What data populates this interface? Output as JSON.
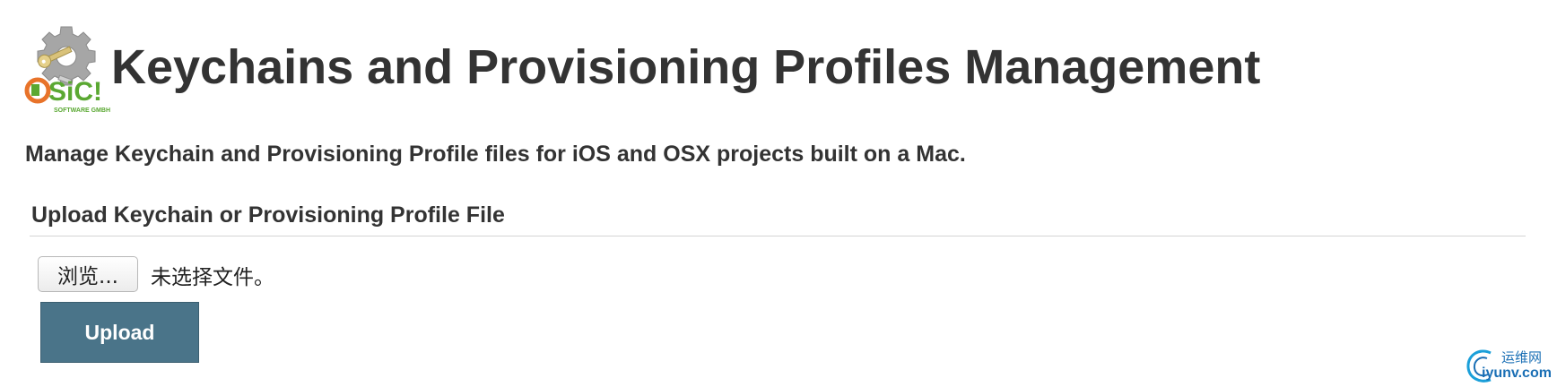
{
  "header": {
    "title": "Keychains and Provisioning Profiles Management",
    "logo_icon": "sic-software-gear-key-logo-icon",
    "logo_text": "SiC!",
    "logo_subtext": "SOFTWARE GMBH"
  },
  "description": "Manage Keychain and Provisioning Profile files for iOS and OSX projects built on a Mac.",
  "upload_section": {
    "title": "Upload Keychain or Provisioning Profile File",
    "browse_label": "浏览...",
    "file_status": "未选择文件。",
    "upload_label": "Upload"
  },
  "watermark": {
    "icon": "iyunv-swirl-icon",
    "cn_text": "运维网",
    "url": "iyunv.com"
  },
  "colors": {
    "upload_button": "#4a7489",
    "text": "#333333",
    "logo_green": "#5aa832",
    "logo_orange": "#e8732a",
    "watermark_blue": "#1a6fb5"
  }
}
